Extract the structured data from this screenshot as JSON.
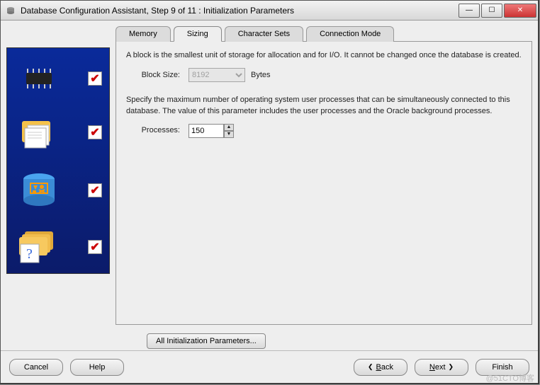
{
  "window": {
    "title": "Database Configuration Assistant, Step 9 of 11 : Initialization Parameters"
  },
  "tabs": {
    "memory": "Memory",
    "sizing": "Sizing",
    "charsets": "Character Sets",
    "connmode": "Connection Mode"
  },
  "sizing": {
    "desc1": "A block is the smallest unit of storage for allocation and for I/O. It cannot be changed once the database is created.",
    "block_size_label": "Block Size:",
    "block_size_value": "8192",
    "block_size_unit": "Bytes",
    "desc2": "Specify the maximum number of operating system user processes that can be simultaneously connected to this database. The value of this parameter includes the user processes and the Oracle background processes.",
    "processes_label": "Processes:",
    "processes_value": "150"
  },
  "all_params_button": "All Initialization Parameters...",
  "buttons": {
    "cancel": "Cancel",
    "help": "Help",
    "back": "Back",
    "next": "Next",
    "finish": "Finish"
  },
  "watermark": "@51CTO博客"
}
